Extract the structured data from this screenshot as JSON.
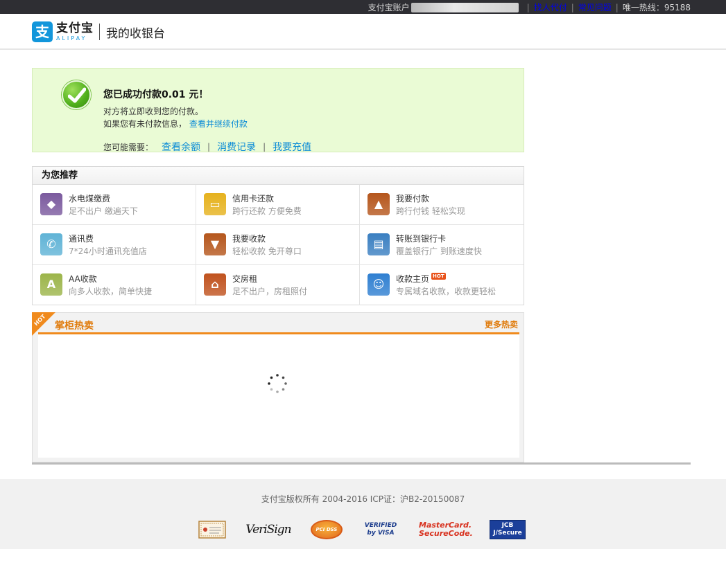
{
  "topbar": {
    "account_label": "支付宝账户",
    "links": [
      "找人代付",
      "常见问题"
    ],
    "hotline": "唯一热线：95188"
  },
  "header": {
    "logo_glyph": "支",
    "logo_cn": "支付宝",
    "logo_en": "ALIPAY",
    "title": "我的收银台"
  },
  "success": {
    "title": "您已成功付款0.01 元！",
    "line1": "对方将立即收到您的付款。",
    "line2_prefix": "如果您有未付款信息，",
    "line2_link": "查看并继续付款",
    "line3_prefix": "您可能需要：",
    "links": [
      "查看余额",
      "消费记录",
      "我要充值"
    ]
  },
  "recommend": {
    "heading": "为您推荐",
    "items": [
      {
        "name": "水电煤缴费",
        "desc": "足不出户 缴遍天下",
        "icon": "utility-icon",
        "color": "#7b5a9e"
      },
      {
        "name": "信用卡还款",
        "desc": "跨行还款 方便免费",
        "icon": "credit-card-icon",
        "color": "#e6b21e"
      },
      {
        "name": "我要付款",
        "desc": "跨行付钱 轻松实现",
        "icon": "payment-icon",
        "color": "#b5561c"
      },
      {
        "name": "通讯费",
        "desc": "7*24小时通讯充值店",
        "icon": "mobile-icon",
        "color": "#5fb3d6"
      },
      {
        "name": "我要收款",
        "desc": "轻松收款 免开尊口",
        "icon": "receive-icon",
        "color": "#b5561c"
      },
      {
        "name": "转账到银行卡",
        "desc": "覆盖银行广 到账速度快",
        "icon": "bank-transfer-icon",
        "color": "#3a7fc1"
      },
      {
        "name": "AA收款",
        "desc": "向多人收款，简单快捷",
        "icon": "aa-icon",
        "color": "#9cb54a"
      },
      {
        "name": "交房租",
        "desc": "足不出户，房租照付",
        "icon": "rent-icon",
        "color": "#c0521e"
      },
      {
        "name": "收款主页",
        "desc": "专属域名收款，收款更轻松",
        "icon": "homepage-icon",
        "color": "#2f7fd1",
        "hot": "HOT"
      }
    ]
  },
  "hotsell": {
    "corner": "HOT",
    "title": "掌柜热卖",
    "more": "更多热卖"
  },
  "footer": {
    "copyright": "支付宝版权所有 2004-2016 ICP证：沪B2-20150087",
    "badges": [
      "VeriSign",
      "PCI DSS",
      "VERIFIED by VISA",
      "MasterCard. SecureCode.",
      "JCB J/Secure"
    ]
  }
}
